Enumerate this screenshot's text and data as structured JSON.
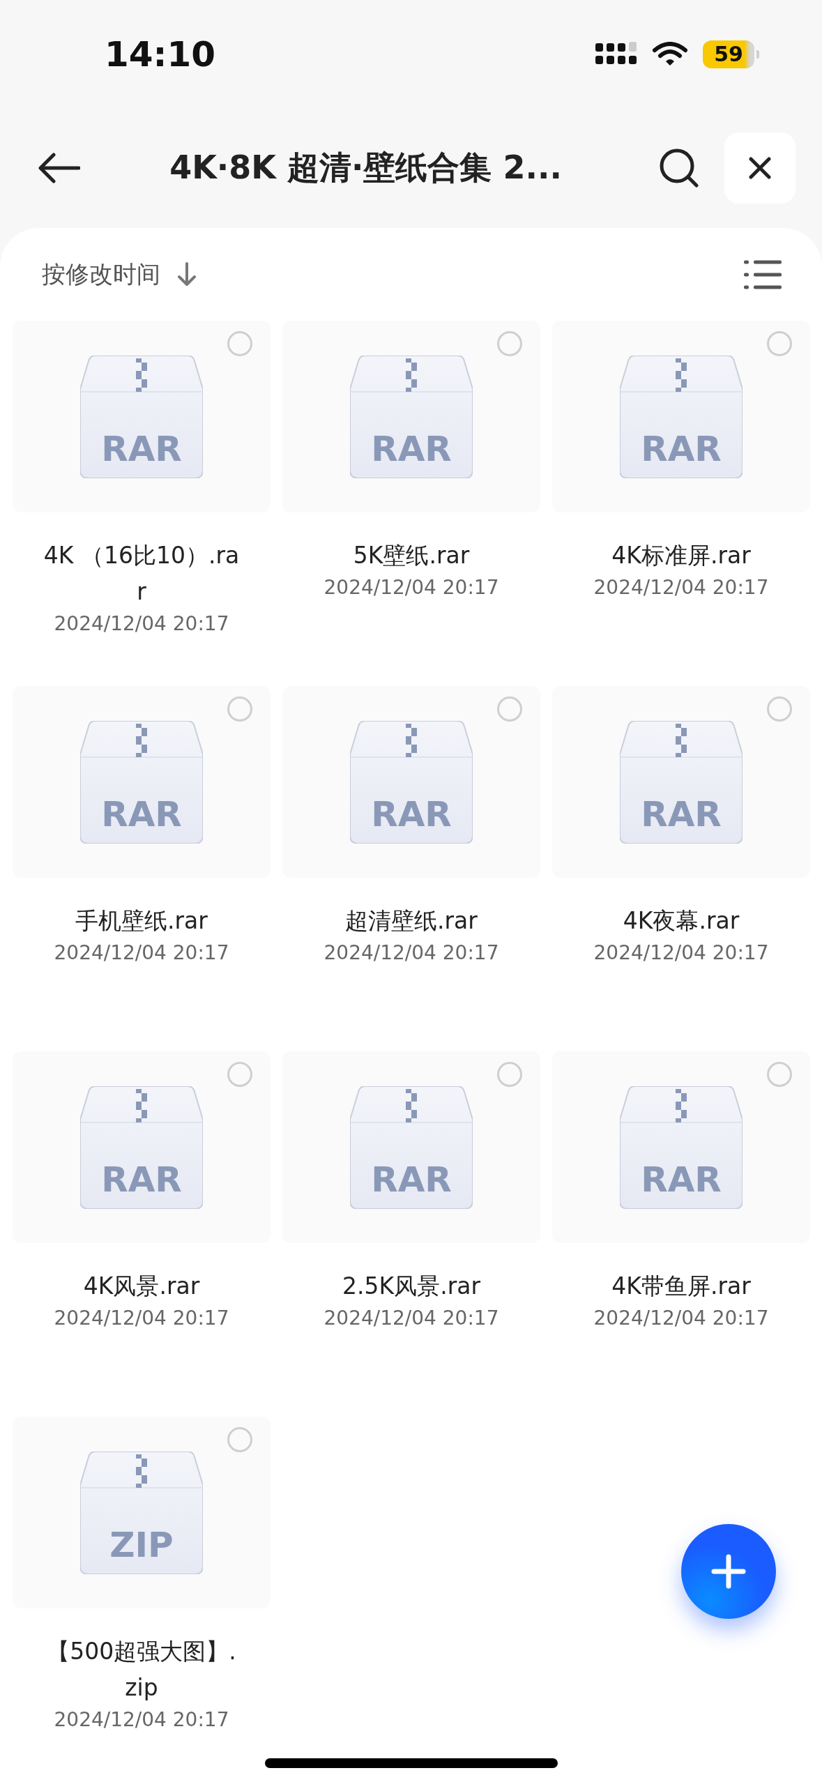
{
  "status_bar": {
    "time": "14:10",
    "battery": "59"
  },
  "header": {
    "title": "4K·8K 超清·壁纸合集 2..."
  },
  "sort": {
    "label": "按修改时间"
  },
  "files": [
    {
      "name": "4K （16比10）.rar",
      "date": "2024/12/04 20:17",
      "type": "RAR",
      "selected": false
    },
    {
      "name": "5K壁纸.rar",
      "date": "2024/12/04 20:17",
      "type": "RAR",
      "selected": false
    },
    {
      "name": "4K标准屏.rar",
      "date": "2024/12/04 20:17",
      "type": "RAR",
      "selected": false
    },
    {
      "name": "手机壁纸.rar",
      "date": "2024/12/04 20:17",
      "type": "RAR",
      "selected": false
    },
    {
      "name": "超清壁纸.rar",
      "date": "2024/12/04 20:17",
      "type": "RAR",
      "selected": false
    },
    {
      "name": "4K夜幕.rar",
      "date": "2024/12/04 20:17",
      "type": "RAR",
      "selected": false
    },
    {
      "name": "4K风景.rar",
      "date": "2024/12/04 20:17",
      "type": "RAR",
      "selected": false
    },
    {
      "name": "2.5K风景.rar",
      "date": "2024/12/04 20:17",
      "type": "RAR",
      "selected": false
    },
    {
      "name": "4K带鱼屏.rar",
      "date": "2024/12/04 20:17",
      "type": "RAR",
      "selected": false
    },
    {
      "name": "【500超强大图】.zip",
      "date": "2024/12/04 20:17",
      "type": "ZIP",
      "selected": false
    }
  ]
}
